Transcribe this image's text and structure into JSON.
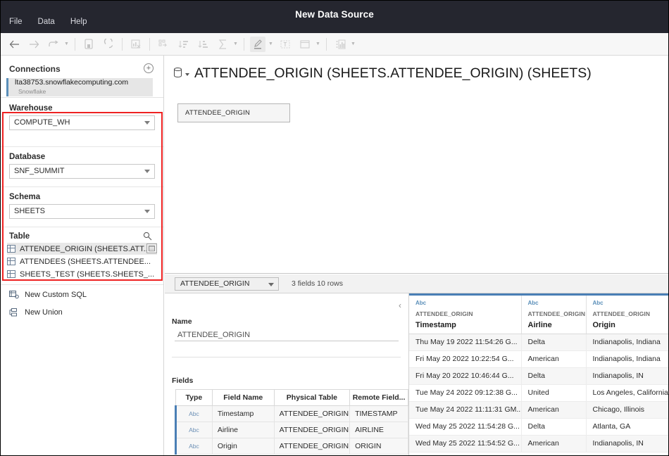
{
  "window": {
    "title": "New Data Source",
    "menu": [
      "File",
      "Data",
      "Help"
    ]
  },
  "toolbar": {
    "items": [
      {
        "name": "back-arrow-icon",
        "label": "←"
      },
      {
        "name": "forward-arrow-icon",
        "label": "→"
      },
      {
        "name": "refresh-loop-icon",
        "label": "↷"
      },
      {
        "name": "history-dropdown-caret",
        "label": "▾"
      },
      {
        "name": "save-icon",
        "label": "⛁"
      },
      {
        "name": "refresh-data-icon",
        "label": "↻"
      },
      {
        "name": "clear-sheet-icon",
        "label": "὜e"
      },
      {
        "name": "pivot-icon",
        "label": "⬚"
      },
      {
        "name": "sort-ascending-icon",
        "label": "↧"
      },
      {
        "name": "sort-descending-icon",
        "label": "↧"
      },
      {
        "name": "aggregate-sigma-icon",
        "label": "Σ"
      },
      {
        "name": "aggregate-caret",
        "label": "▾"
      },
      {
        "name": "highlighter-icon",
        "label": "✎"
      },
      {
        "name": "highlighter-caret",
        "label": "▾"
      },
      {
        "name": "text-label-icon",
        "label": "T"
      },
      {
        "name": "container-icon",
        "label": "▭"
      },
      {
        "name": "container-caret",
        "label": "▾"
      },
      {
        "name": "show-me-chart-icon",
        "label": "☷"
      },
      {
        "name": "show-me-caret",
        "label": "▾"
      }
    ]
  },
  "connections": {
    "header": "Connections",
    "add_label": "+",
    "active": {
      "server": "lta38753.snowflakecomputing.com",
      "type": "Snowflake"
    }
  },
  "warehouse": {
    "label": "Warehouse",
    "value": "COMPUTE_WH"
  },
  "database": {
    "label": "Database",
    "value": "SNF_SUMMIT"
  },
  "schema": {
    "label": "Schema",
    "value": "SHEETS"
  },
  "table_section": {
    "label": "Table",
    "search_icon": "search-icon",
    "items": [
      {
        "label": "ATTENDEE_ORIGIN (SHEETS.ATT...",
        "selected": true
      },
      {
        "label": "ATTENDEES (SHEETS.ATTENDEE...",
        "selected": false
      },
      {
        "label": "SHEETS_TEST (SHEETS.SHEETS_...",
        "selected": false
      }
    ]
  },
  "actions": [
    {
      "label": "New Custom SQL",
      "icon": "custom-sql-icon"
    },
    {
      "label": "New Union",
      "icon": "new-union-icon"
    }
  ],
  "canvas": {
    "title": "ATTENDEE_ORIGIN (SHEETS.ATTENDEE_ORIGIN) (SHEETS)",
    "db_icon": "database-icon",
    "table_card": "ATTENDEE_ORIGIN"
  },
  "preview_toolbar": {
    "selected_table": "ATTENDEE_ORIGIN",
    "meta": "3 fields 10 rows"
  },
  "metadata_pane": {
    "collapse_icon": "chevron-left-icon",
    "name_label": "Name",
    "name_value": "ATTENDEE_ORIGIN",
    "fields_label": "Fields",
    "fields_headers": [
      "Type",
      "Field Name",
      "Physical Table",
      "Remote Field..."
    ],
    "fields_rows": [
      {
        "type": "Abc",
        "field_name": "Timestamp",
        "physical_table": "ATTENDEE_ORIGIN",
        "remote_field": "TIMESTAMP"
      },
      {
        "type": "Abc",
        "field_name": "Airline",
        "physical_table": "ATTENDEE_ORIGIN",
        "remote_field": "AIRLINE"
      },
      {
        "type": "Abc",
        "field_name": "Origin",
        "physical_table": "ATTENDEE_ORIGIN",
        "remote_field": "ORIGIN"
      }
    ]
  },
  "data_grid": {
    "columns": [
      {
        "type": "Abc",
        "table": "ATTENDEE_ORIGIN",
        "name": "Timestamp"
      },
      {
        "type": "Abc",
        "table": "ATTENDEE_ORIGIN",
        "name": "Airline"
      },
      {
        "type": "Abc",
        "table": "ATTENDEE_ORIGIN",
        "name": "Origin"
      }
    ],
    "rows": [
      [
        "Thu May 19 2022 11:54:26 G...",
        "Delta",
        "Indianapolis, Indiana"
      ],
      [
        "Fri May 20 2022 10:22:54 G...",
        "American",
        "Indianapolis, Indiana"
      ],
      [
        "Fri May 20 2022 10:46:44 G...",
        "Delta",
        "Indianapolis, IN"
      ],
      [
        "Tue May 24 2022 09:12:38 G...",
        "United",
        "Los Angeles, California"
      ],
      [
        "Tue May 24 2022 11:11:31 GM...",
        "American",
        "Chicago, Illinois"
      ],
      [
        "Wed May 25 2022 11:54:28 G...",
        "Delta",
        "Atlanta, GA"
      ],
      [
        "Wed May 25 2022 11:54:52 G...",
        "American",
        "Indianapolis, IN"
      ]
    ]
  },
  "colors": {
    "titlebar": "#25262f",
    "highlight_box": "#ee2222",
    "accent_blue": "#4a7fb5"
  }
}
